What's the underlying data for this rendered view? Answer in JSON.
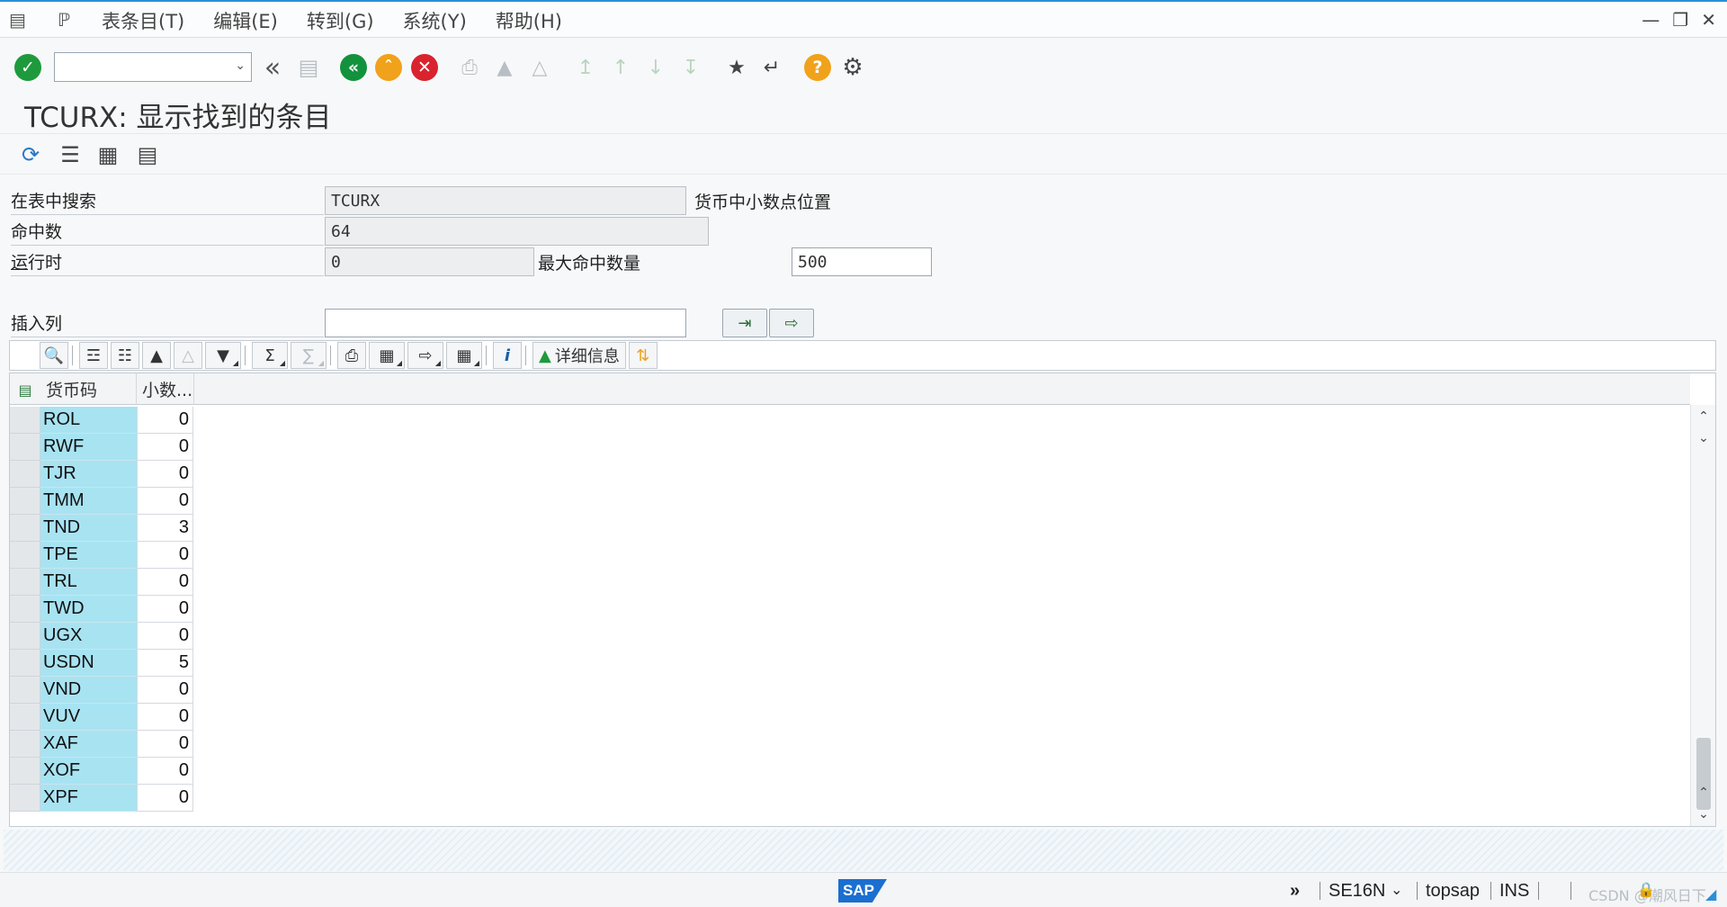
{
  "menubar": {
    "items": [
      "表条目(T)",
      "编辑(E)",
      "转到(G)",
      "系统(Y)",
      "帮助(H)"
    ]
  },
  "toolbar": {
    "command_value": "",
    "icons": [
      "enter-icon",
      "back-icon",
      "save-icon",
      "green-back-icon",
      "exit-icon",
      "cancel-icon",
      "print-icon",
      "find-icon",
      "find-next-icon",
      "first-page-icon",
      "previous-page-icon",
      "next-page-icon",
      "last-page-icon",
      "new-session-icon",
      "shortcut-icon",
      "help-icon",
      "settings-icon"
    ]
  },
  "page": {
    "title": "TCURX: 显示找到的条目"
  },
  "form": {
    "search_table_label": "在表中搜索",
    "search_table_value": "TCURX",
    "search_table_desc": "货币中小数点位置",
    "hits_label": "命中数",
    "hits_value": "64",
    "runtime_label_u": "运",
    "runtime_label_rest": "行时",
    "runtime_value": "0",
    "max_hits_label": "最大命中数量",
    "max_hits_value": "500",
    "insert_col_label": "插入列",
    "insert_col_value": ""
  },
  "alv_toolbar": {
    "details_label": "详细信息",
    "sum_label": "Σ"
  },
  "grid": {
    "columns": [
      "货币码",
      "小数..."
    ],
    "rows": [
      {
        "currency": "ROL",
        "decimals": "0"
      },
      {
        "currency": "RWF",
        "decimals": "0"
      },
      {
        "currency": "TJR",
        "decimals": "0"
      },
      {
        "currency": "TMM",
        "decimals": "0"
      },
      {
        "currency": "TND",
        "decimals": "3"
      },
      {
        "currency": "TPE",
        "decimals": "0"
      },
      {
        "currency": "TRL",
        "decimals": "0"
      },
      {
        "currency": "TWD",
        "decimals": "0"
      },
      {
        "currency": "UGX",
        "decimals": "0"
      },
      {
        "currency": "USDN",
        "decimals": "5"
      },
      {
        "currency": "VND",
        "decimals": "0"
      },
      {
        "currency": "VUV",
        "decimals": "0"
      },
      {
        "currency": "XAF",
        "decimals": "0"
      },
      {
        "currency": "XOF",
        "decimals": "0"
      },
      {
        "currency": "XPF",
        "decimals": "0"
      }
    ]
  },
  "statusbar": {
    "logo": "SAP",
    "transaction": "SE16N",
    "system": "topsap",
    "mode": "INS",
    "watermark": "CSDN @潮风日下"
  },
  "colors": {
    "key_column": "#a8e3f2",
    "enter_green": "#1e9a3c",
    "back_green": "#12923c",
    "exit_orange": "#f0a21a",
    "cancel_red": "#d9232e",
    "accent_blue": "#2a8fd6"
  }
}
